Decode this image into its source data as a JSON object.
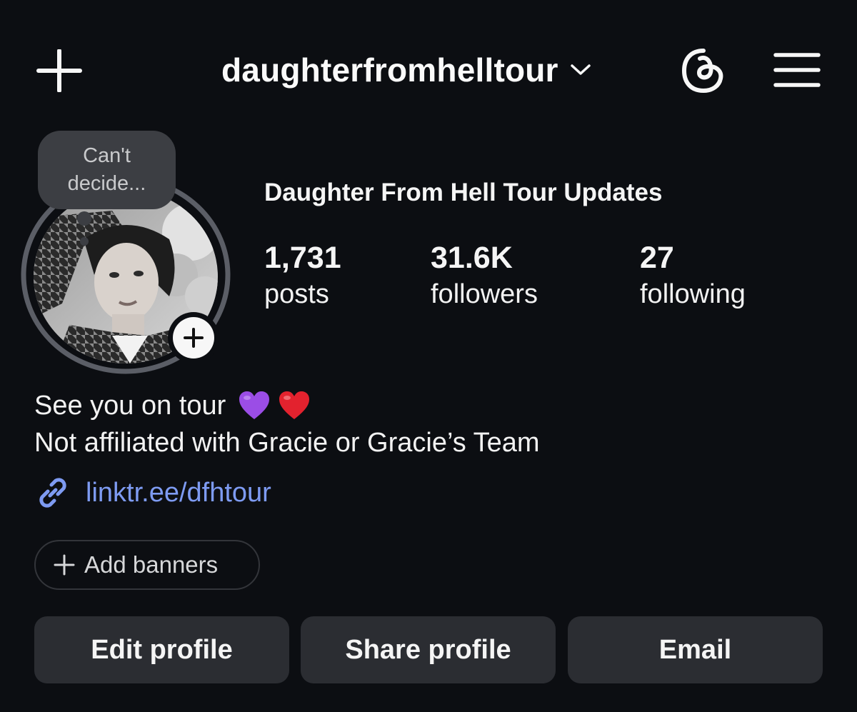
{
  "header": {
    "username": "daughterfromhelltour",
    "create_icon": "plus-icon",
    "dropdown_icon": "chevron-down-icon",
    "threads_icon": "threads-icon",
    "menu_icon": "hamburger-menu-icon"
  },
  "profile": {
    "note": "Can't decide...",
    "display_name": "Daughter From Hell Tour Updates",
    "stats": [
      {
        "value": "1,731",
        "label": "posts"
      },
      {
        "value": "31.6K",
        "label": "followers"
      },
      {
        "value": "27",
        "label": "following"
      }
    ]
  },
  "bio": {
    "line1": "See you on tour",
    "line1_emojis": [
      "purple-heart-icon",
      "red-heart-icon"
    ],
    "line2": "Not affiliated with Gracie or Gracie’s Team",
    "link": "linktr.ee/dfhtour"
  },
  "banners": {
    "label": "Add banners"
  },
  "actions": {
    "edit": "Edit profile",
    "share": "Share profile",
    "email": "Email"
  },
  "colors": {
    "background": "#0c0e12",
    "button_bg": "#2b2d32",
    "link": "#7e9bf2",
    "note_bubble": "#3c3e43"
  }
}
